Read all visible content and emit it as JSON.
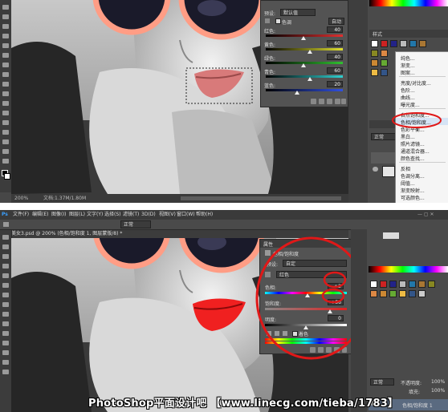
{
  "top": {
    "status": {
      "zoom": "200%",
      "doc_info": "文档:1.37M/1.80M"
    },
    "adjust_panel": {
      "preset_label": "预设:",
      "preset_value": "默认值",
      "auto_button": "自动",
      "hue_checkbox_label": "色调",
      "rows": [
        {
          "label": "红色:",
          "value": "40"
        },
        {
          "label": "黄色:",
          "value": "60"
        },
        {
          "label": "绿色:",
          "value": "40"
        },
        {
          "label": "青色:",
          "value": "60"
        },
        {
          "label": "蓝色:",
          "value": "20"
        }
      ]
    },
    "panel_tabs": {
      "tab_label": "样式"
    },
    "context_menu": {
      "items": [
        "纯色...",
        "渐变...",
        "图案...",
        "亮度/对比度...",
        "色阶...",
        "曲线...",
        "曝光度...",
        "自然饱和度...",
        "色相/饱和度...",
        "色彩平衡...",
        "黑白...",
        "照片滤镜...",
        "通道混合器...",
        "颜色查找...",
        "反相",
        "色调分离...",
        "阈值...",
        "渐变映射...",
        "可选颜色..."
      ],
      "highlighted": "色相/饱和度..."
    },
    "layers_panel": {
      "blend_mode": "正常"
    }
  },
  "bottom": {
    "menubar": {
      "logo": "Ps",
      "items": [
        "文件(F)",
        "编辑(E)",
        "图像(I)",
        "图层(L)",
        "文字(Y)",
        "选择(S)",
        "滤镜(T)",
        "3D(D)",
        "视图(V)",
        "窗口(W)",
        "帮助(H)"
      ]
    },
    "options_bar": {
      "mode": "正常"
    },
    "doc_tab": "美女3.psd @ 200% (色相/饱和度 1, 图层蒙版/8) *",
    "hue_panel": {
      "title": "属性",
      "adjust_name": "色相/饱和度",
      "preset_label": "预设:",
      "preset_value": "自定",
      "channel_value": "红色",
      "rows": [
        {
          "label": "色相:",
          "value": "+2"
        },
        {
          "label": "饱和度:",
          "value": "+56"
        },
        {
          "label": "明度:",
          "value": "0"
        }
      ],
      "colorize_label": "着色"
    },
    "layers_panel": {
      "blend_mode": "正常",
      "opacity_label": "不透明度:",
      "opacity_value": "100%",
      "fill_label": "填充:",
      "fill_value": "100%",
      "layer_name": "色相/饱和度 1"
    },
    "watermark": "PhotoShop平面设计吧 【www.linecg.com/tieba/1783】"
  },
  "colors": {
    "highlight_red": "#e01818",
    "app_bg": "#474747",
    "panel_bg": "#535353"
  }
}
